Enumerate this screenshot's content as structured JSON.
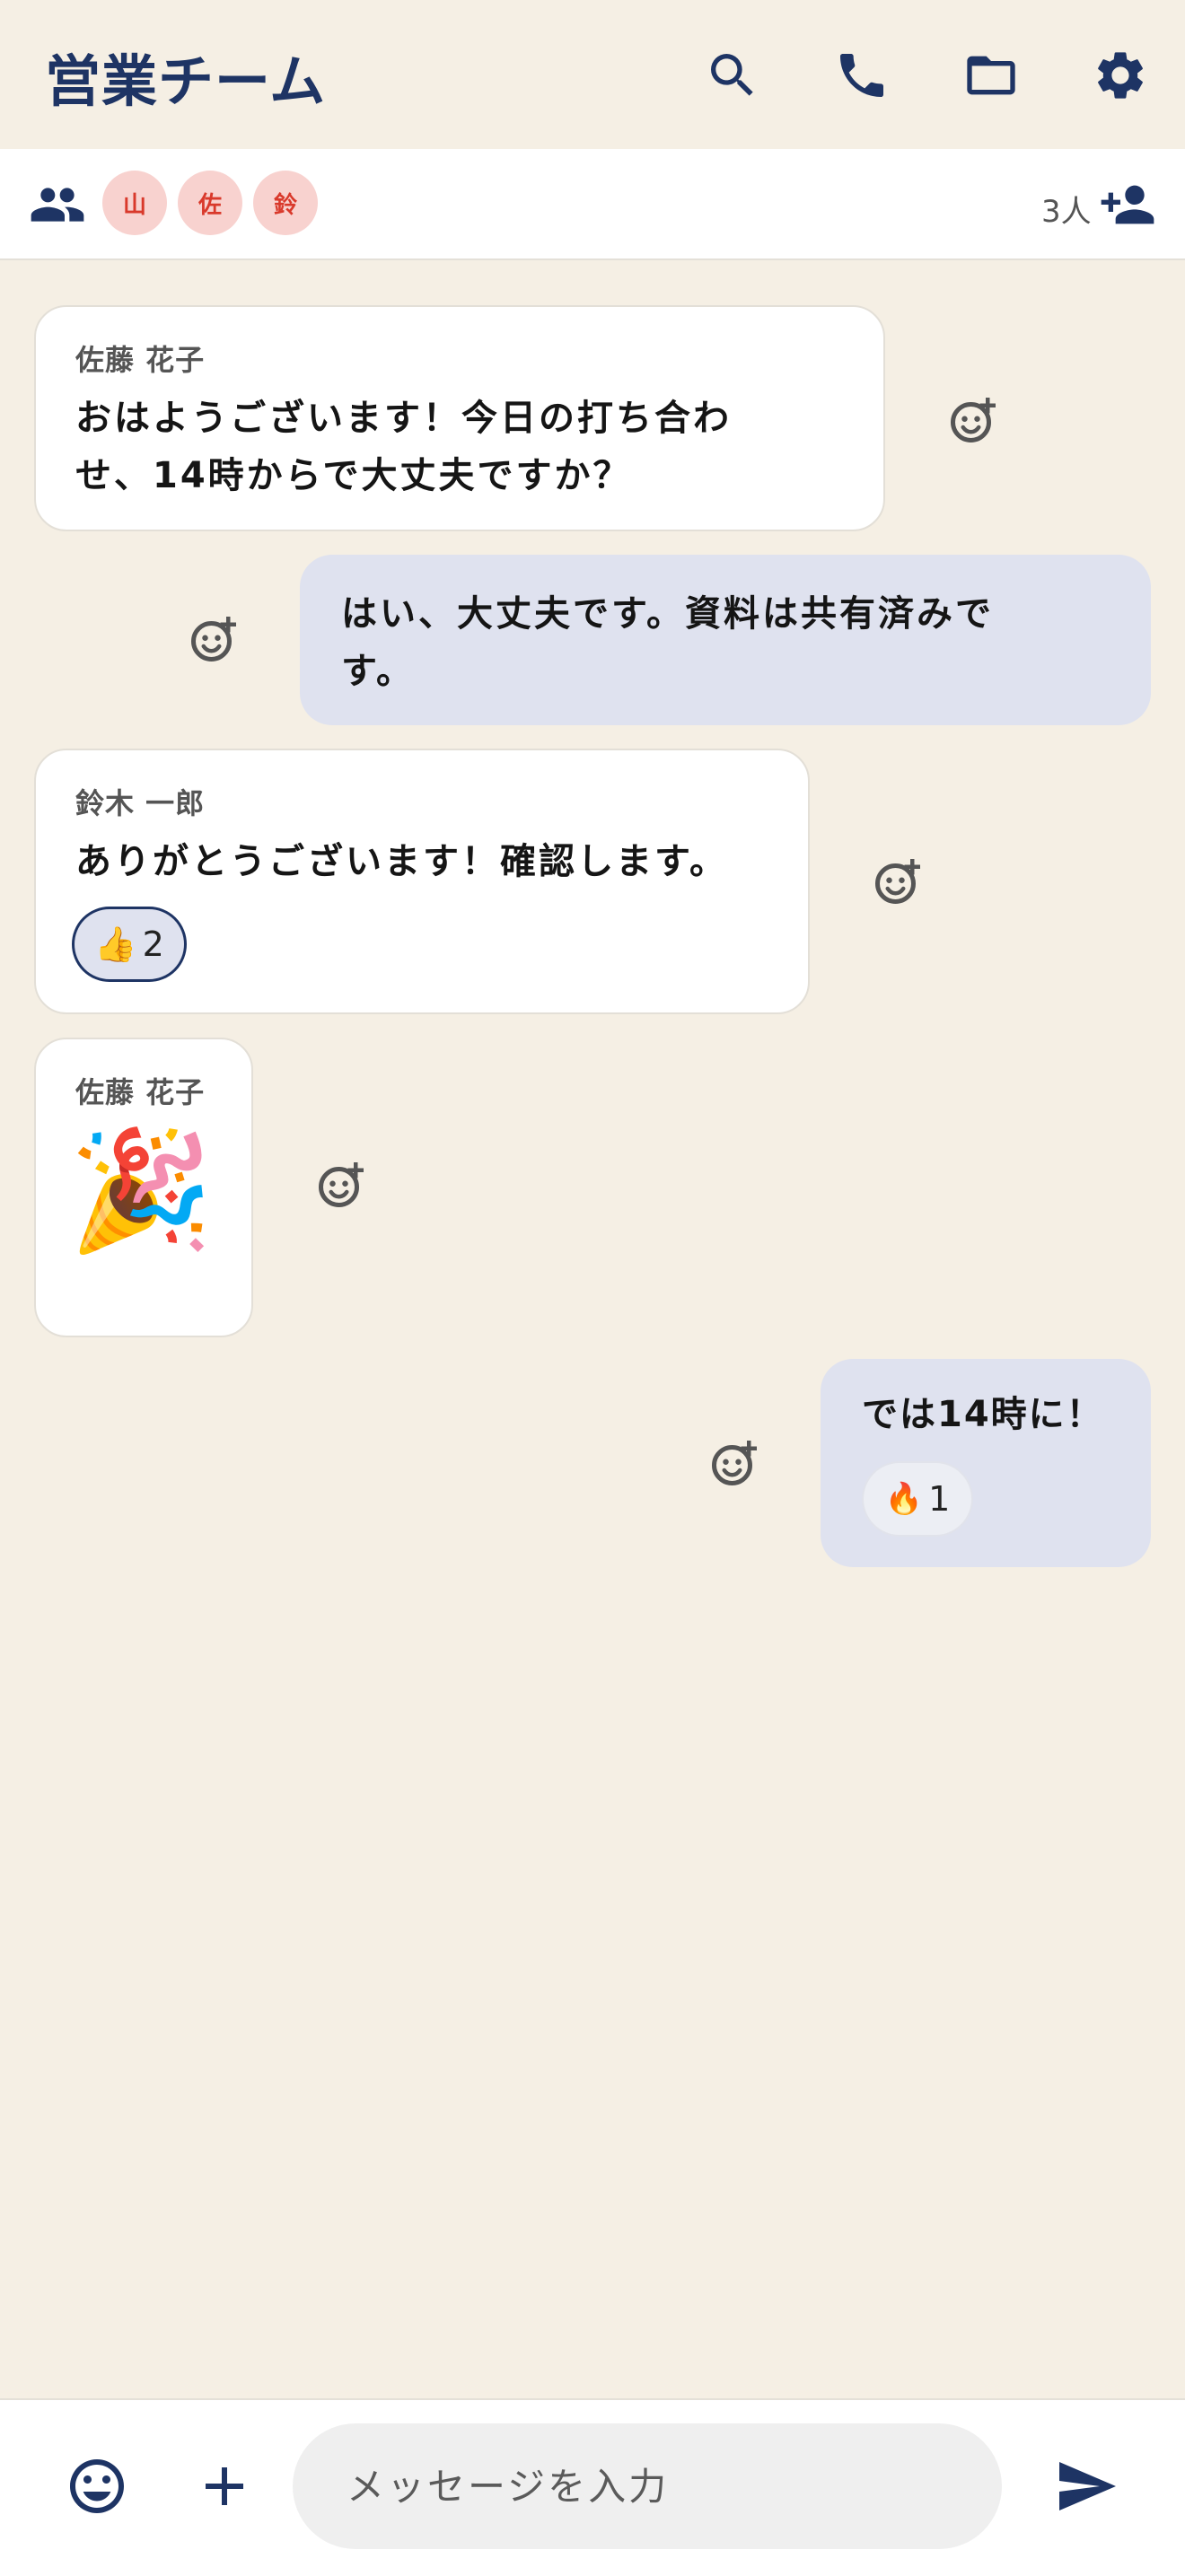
{
  "header": {
    "title": "営業チーム"
  },
  "members": {
    "avatars": [
      "山",
      "佐",
      "鈴"
    ],
    "count": "3人"
  },
  "messages": [
    {
      "sender": "佐藤 花子",
      "text": "おはようございます！今日の打ち合わせ、14時からで大丈夫ですか？"
    },
    {
      "text": "はい、大丈夫です。資料は共有済みです。"
    },
    {
      "sender": "鈴木 一郎",
      "text": "ありがとうございます！確認します。",
      "reaction": {
        "emoji": "👍",
        "count": "2"
      }
    },
    {
      "sender": "佐藤 花子",
      "sticker": "🎉"
    },
    {
      "text": "では14時に！",
      "reaction": {
        "emoji": "🔥",
        "count": "1"
      }
    }
  ],
  "composer": {
    "placeholder": "メッセージを入力"
  },
  "colors": {
    "background": "#f5efe4",
    "accent": "#1e3464",
    "outgoing_bubble": "#dfe2ef",
    "avatar_bg": "#f8d2cf",
    "avatar_text": "#d9392b"
  }
}
